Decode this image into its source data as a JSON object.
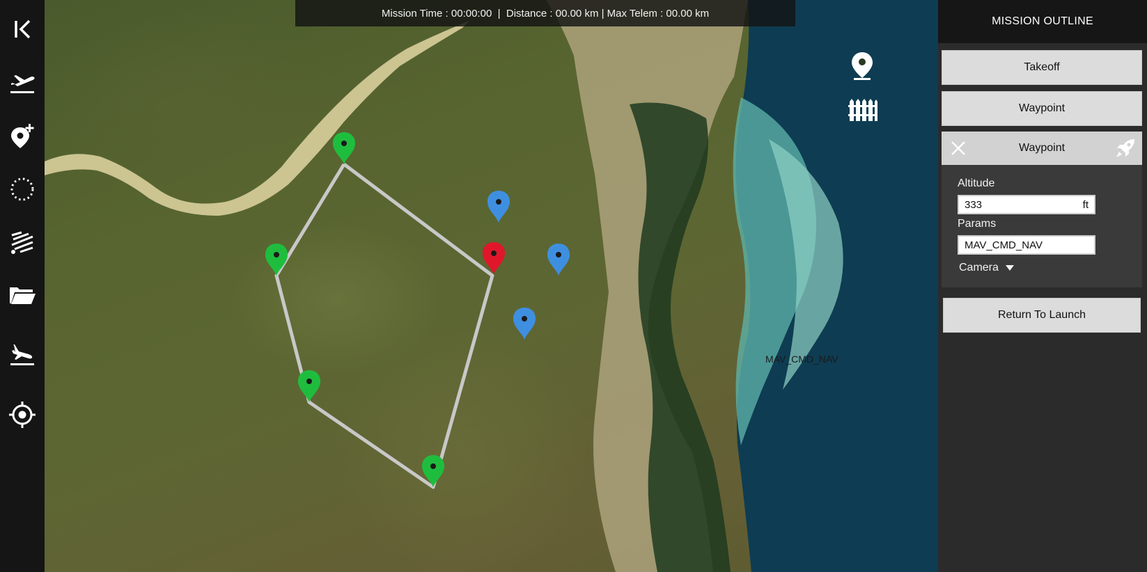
{
  "stats_bar": {
    "mission_time_label": "Mission Time : 00:00:00",
    "sep1": "  |  ",
    "distance_label": "Distance : 00.00 km",
    "sep2": " | ",
    "max_telem_label": "Max Telem : 00.00 km"
  },
  "left_toolbar": {
    "items": [
      {
        "name": "collapse-icon"
      },
      {
        "name": "takeoff-icon"
      },
      {
        "name": "add-waypoint-icon"
      },
      {
        "name": "circle-pattern-icon"
      },
      {
        "name": "survey-pattern-icon"
      },
      {
        "name": "folder-icon"
      },
      {
        "name": "land-icon"
      },
      {
        "name": "target-icon"
      }
    ]
  },
  "map": {
    "overlay_label": "MAV_CMD_NAV",
    "path_color": "#c8c8c8",
    "marker_colors": {
      "green": "#1fbd3e",
      "red": "#e0172b",
      "blue": "#3f8fe0"
    },
    "tools": [
      {
        "name": "map-pin-icon"
      },
      {
        "name": "geofence-icon"
      }
    ]
  },
  "mission_panel": {
    "title": "MISSION OUTLINE",
    "items": [
      {
        "label": "Takeoff"
      },
      {
        "label": "Waypoint"
      }
    ],
    "expanded_item": {
      "label": "Waypoint",
      "altitude_label": "Altitude",
      "altitude_value": "333",
      "altitude_unit": "ft",
      "params_label": "Params",
      "params_value": "MAV_CMD_NAV",
      "camera_label": "Camera"
    },
    "return_to_launch_label": "Return To Launch"
  }
}
